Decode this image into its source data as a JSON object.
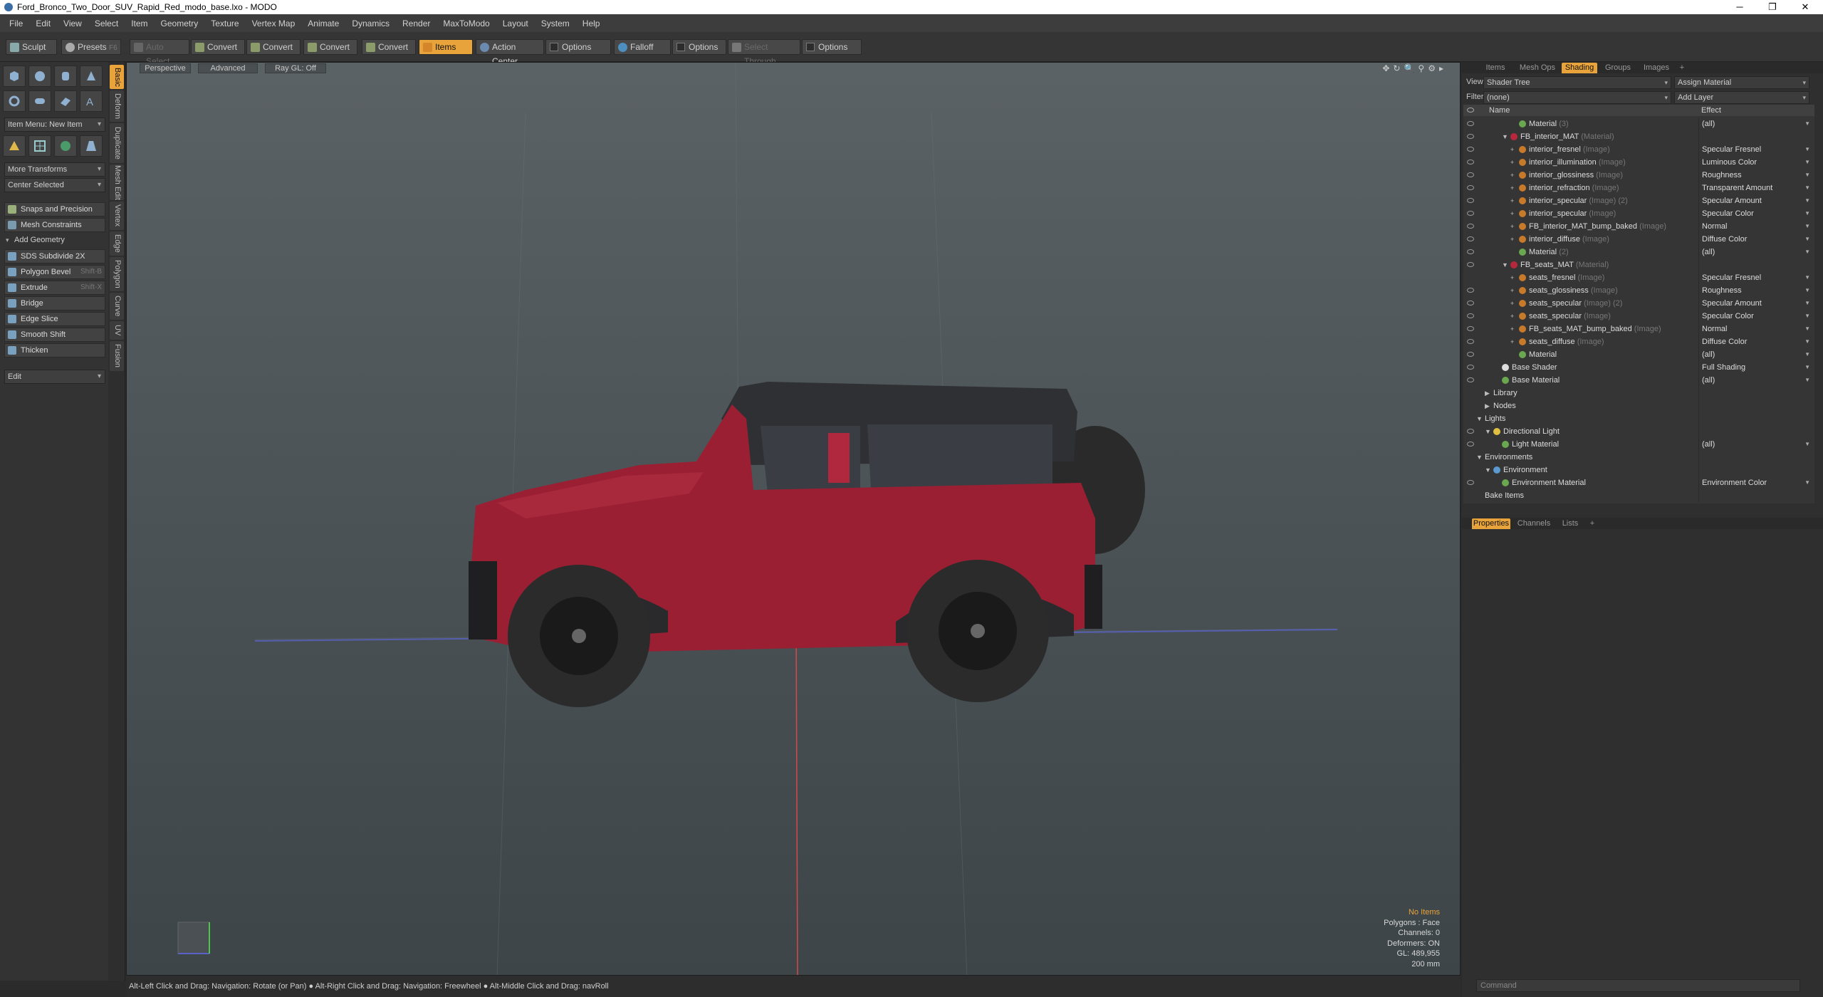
{
  "window": {
    "title": "Ford_Bronco_Two_Door_SUV_Rapid_Red_modo_base.lxo - MODO",
    "minimize": "─",
    "restore": "❐",
    "close": "✕"
  },
  "menu": [
    "File",
    "Edit",
    "View",
    "Select",
    "Item",
    "Geometry",
    "Texture",
    "Vertex Map",
    "Animate",
    "Dynamics",
    "Render",
    "MaxToModo",
    "Layout",
    "System",
    "Help"
  ],
  "toolbar": {
    "sculpt": "Sculpt",
    "presets": "Presets",
    "presets_key": "F6",
    "auto_select": "Auto Select",
    "convert1": "Convert",
    "convert2": "Convert",
    "convert3": "Convert",
    "convert4": "Convert",
    "items": "Items",
    "action_center": "Action Center",
    "options1": "Options",
    "falloff": "Falloff",
    "options2": "Options",
    "select_through": "Select Through",
    "options3": "Options"
  },
  "left": {
    "item_menu": "Item Menu: New Item",
    "more_transforms": "More Transforms",
    "center_selected": "Center Selected",
    "snaps": "Snaps and Precision",
    "mesh_constraints": "Mesh Constraints",
    "add_geometry": "Add Geometry",
    "tools": [
      {
        "label": "SDS Subdivide 2X",
        "shortcut": ""
      },
      {
        "label": "Polygon Bevel",
        "shortcut": "Shift-B"
      },
      {
        "label": "Extrude",
        "shortcut": "Shift-X"
      },
      {
        "label": "Bridge",
        "shortcut": ""
      },
      {
        "label": "Edge Slice",
        "shortcut": ""
      },
      {
        "label": "Smooth Shift",
        "shortcut": ""
      },
      {
        "label": "Thicken",
        "shortcut": ""
      }
    ],
    "edit": "Edit",
    "vtabs": [
      "Basic",
      "Deform",
      "Duplicate",
      "Mesh Edit",
      "Vertex",
      "Edge",
      "Polygon",
      "Curve",
      "UV",
      "Fusion"
    ]
  },
  "viewport": {
    "perspective": "Perspective",
    "advanced": "Advanced",
    "raygl": "Ray GL: Off",
    "info": {
      "no_items": "No Items",
      "polygons": "Polygons : Face",
      "channels": "Channels: 0",
      "deformers": "Deformers: ON",
      "gl": "GL: 489,955",
      "scale": "200 mm"
    }
  },
  "status": "Alt-Left Click and Drag: Navigation: Rotate (or Pan) ● Alt-Right Click and Drag: Navigation: Freewheel ● Alt-Middle Click and Drag: navRoll",
  "right": {
    "tabs": [
      "Items",
      "Mesh Ops",
      "Shading",
      "Groups",
      "Images",
      "+"
    ],
    "view_label": "View",
    "view_value": "Shader Tree",
    "assign_material": "Assign Material",
    "filter_label": "Filter",
    "filter_value": "(none)",
    "add_layer": "Add Layer",
    "col_name": "Name",
    "col_effect": "Effect",
    "rows": [
      {
        "name": "Material",
        "type": "(3)",
        "effect": "(all)",
        "indent": 4,
        "icon": "mat",
        "exp": "",
        "eye": true
      },
      {
        "name": "FB_interior_MAT",
        "type": "(Material)",
        "effect": "",
        "indent": 3,
        "icon": "red",
        "exp": "▼",
        "eye": true
      },
      {
        "name": "interior_fresnel",
        "type": "(Image)",
        "effect": "Specular Fresnel",
        "indent": 4,
        "icon": "img",
        "exp": "+",
        "eye": true
      },
      {
        "name": "interior_illumination",
        "type": "(Image)",
        "effect": "Luminous Color",
        "indent": 4,
        "icon": "img",
        "exp": "+",
        "eye": true
      },
      {
        "name": "interior_glossiness",
        "type": "(Image)",
        "effect": "Roughness",
        "indent": 4,
        "icon": "img",
        "exp": "+",
        "eye": true
      },
      {
        "name": "interior_refraction",
        "type": "(Image)",
        "effect": "Transparent Amount",
        "indent": 4,
        "icon": "img",
        "exp": "+",
        "eye": true
      },
      {
        "name": "interior_specular",
        "type": "(Image) (2)",
        "effect": "Specular Amount",
        "indent": 4,
        "icon": "img",
        "exp": "+",
        "eye": true
      },
      {
        "name": "interior_specular",
        "type": "(Image)",
        "effect": "Specular Color",
        "indent": 4,
        "icon": "img",
        "exp": "+",
        "eye": true
      },
      {
        "name": "FB_interior_MAT_bump_baked",
        "type": "(Image)",
        "effect": "Normal",
        "indent": 4,
        "icon": "img",
        "exp": "+",
        "eye": true
      },
      {
        "name": "interior_diffuse",
        "type": "(Image)",
        "effect": "Diffuse Color",
        "indent": 4,
        "icon": "img",
        "exp": "+",
        "eye": true
      },
      {
        "name": "Material",
        "type": "(2)",
        "effect": "(all)",
        "indent": 4,
        "icon": "mat",
        "exp": "",
        "eye": true
      },
      {
        "name": "FB_seats_MAT",
        "type": "(Material)",
        "effect": "",
        "indent": 3,
        "icon": "red",
        "exp": "▼",
        "eye": true
      },
      {
        "name": "seats_fresnel",
        "type": "(Image)",
        "effect": "Specular Fresnel",
        "indent": 4,
        "icon": "img",
        "exp": "+",
        "eye": false
      },
      {
        "name": "seats_glossiness",
        "type": "(Image)",
        "effect": "Roughness",
        "indent": 4,
        "icon": "img",
        "exp": "+",
        "eye": true
      },
      {
        "name": "seats_specular",
        "type": "(Image) (2)",
        "effect": "Specular Amount",
        "indent": 4,
        "icon": "img",
        "exp": "+",
        "eye": true
      },
      {
        "name": "seats_specular",
        "type": "(Image)",
        "effect": "Specular Color",
        "indent": 4,
        "icon": "img",
        "exp": "+",
        "eye": true
      },
      {
        "name": "FB_seats_MAT_bump_baked",
        "type": "(Image)",
        "effect": "Normal",
        "indent": 4,
        "icon": "img",
        "exp": "+",
        "eye": true
      },
      {
        "name": "seats_diffuse",
        "type": "(Image)",
        "effect": "Diffuse Color",
        "indent": 4,
        "icon": "img",
        "exp": "+",
        "eye": true
      },
      {
        "name": "Material",
        "type": "",
        "effect": "(all)",
        "indent": 4,
        "icon": "mat",
        "exp": "",
        "eye": true
      },
      {
        "name": "Base Shader",
        "type": "",
        "effect": "Full Shading",
        "indent": 2,
        "icon": "shader",
        "exp": "",
        "eye": true
      },
      {
        "name": "Base Material",
        "type": "",
        "effect": "(all)",
        "indent": 2,
        "icon": "mat",
        "exp": "",
        "eye": true
      },
      {
        "name": "Library",
        "type": "",
        "effect": "",
        "indent": 1,
        "icon": "",
        "exp": "▶",
        "eye": false
      },
      {
        "name": "Nodes",
        "type": "",
        "effect": "",
        "indent": 1,
        "icon": "",
        "exp": "▶",
        "eye": false
      },
      {
        "name": "Lights",
        "type": "",
        "effect": "",
        "indent": 0,
        "icon": "",
        "exp": "▼",
        "eye": false
      },
      {
        "name": "Directional Light",
        "type": "",
        "effect": "",
        "indent": 1,
        "icon": "light",
        "exp": "▼",
        "eye": true
      },
      {
        "name": "Light Material",
        "type": "",
        "effect": "(all)",
        "indent": 2,
        "icon": "mat",
        "exp": "",
        "eye": true
      },
      {
        "name": "Environments",
        "type": "",
        "effect": "",
        "indent": 0,
        "icon": "",
        "exp": "▼",
        "eye": false
      },
      {
        "name": "Environment",
        "type": "",
        "effect": "",
        "indent": 1,
        "icon": "env",
        "exp": "▼",
        "eye": false
      },
      {
        "name": "Environment Material",
        "type": "",
        "effect": "Environment Color",
        "indent": 2,
        "icon": "mat",
        "exp": "",
        "eye": true
      },
      {
        "name": "Bake Items",
        "type": "",
        "effect": "",
        "indent": 0,
        "icon": "",
        "exp": "",
        "eye": false
      }
    ],
    "prop_tabs": [
      "Properties",
      "Channels",
      "Lists",
      "+"
    ],
    "command": "Command"
  },
  "colors": {
    "accent": "#e8a33a",
    "body_paint": "#9b1f33",
    "viewport_top": "#5b6266"
  }
}
